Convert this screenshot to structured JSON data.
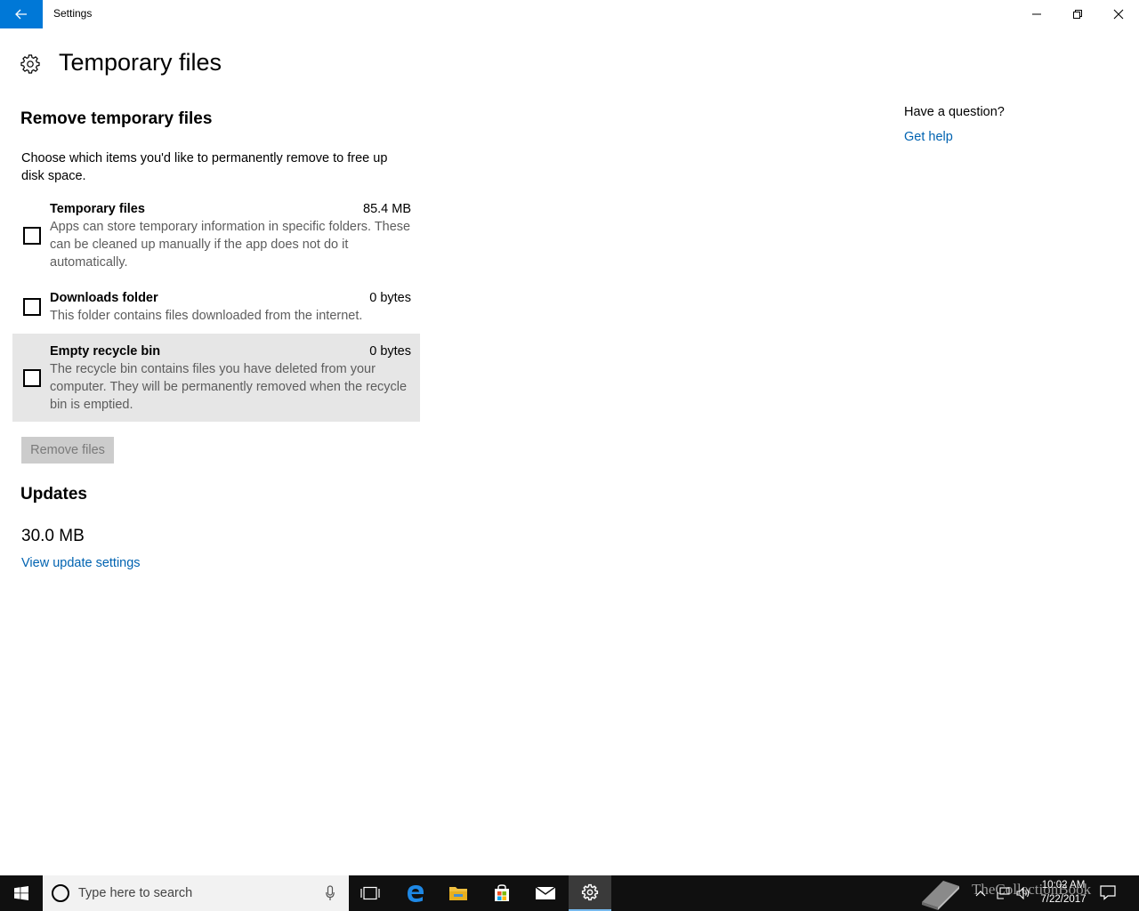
{
  "window": {
    "title": "Settings"
  },
  "page": {
    "title": "Temporary files"
  },
  "remove_section": {
    "heading": "Remove temporary files",
    "description": "Choose which items you'd like to permanently remove to free up disk space.",
    "items": [
      {
        "name": "Temporary files",
        "size": "85.4 MB",
        "description": "Apps can store temporary information in specific folders. These can be cleaned up manually if the app does not do it automatically.",
        "checked": false
      },
      {
        "name": "Downloads folder",
        "size": "0 bytes",
        "description": "This folder contains files downloaded from the internet.",
        "checked": false
      },
      {
        "name": "Empty recycle bin",
        "size": "0 bytes",
        "description": "The recycle bin contains files you have deleted from your computer. They will be permanently removed when the recycle bin is emptied.",
        "checked": false
      }
    ],
    "remove_button": "Remove files"
  },
  "updates_section": {
    "heading": "Updates",
    "size": "30.0 MB",
    "link": "View update settings"
  },
  "help": {
    "question": "Have a question?",
    "link": "Get help"
  },
  "taskbar": {
    "search_placeholder": "Type here to search",
    "clock_time": "10:02 AM",
    "clock_date": "7/22/2017",
    "watermark": "TheCollectionBook",
    "icons": [
      "windows-start-icon",
      "cortana-icon",
      "microphone-icon",
      "task-view-icon",
      "edge-icon",
      "file-explorer-icon",
      "store-icon",
      "mail-icon",
      "settings-icon",
      "network-icon",
      "volume-icon",
      "action-center-icon"
    ]
  },
  "colors": {
    "accent": "#0078d7",
    "link": "#0063b1",
    "hover_row": "#e6e6e6",
    "disabled_button": "#cccccc",
    "taskbar": "#101010"
  }
}
